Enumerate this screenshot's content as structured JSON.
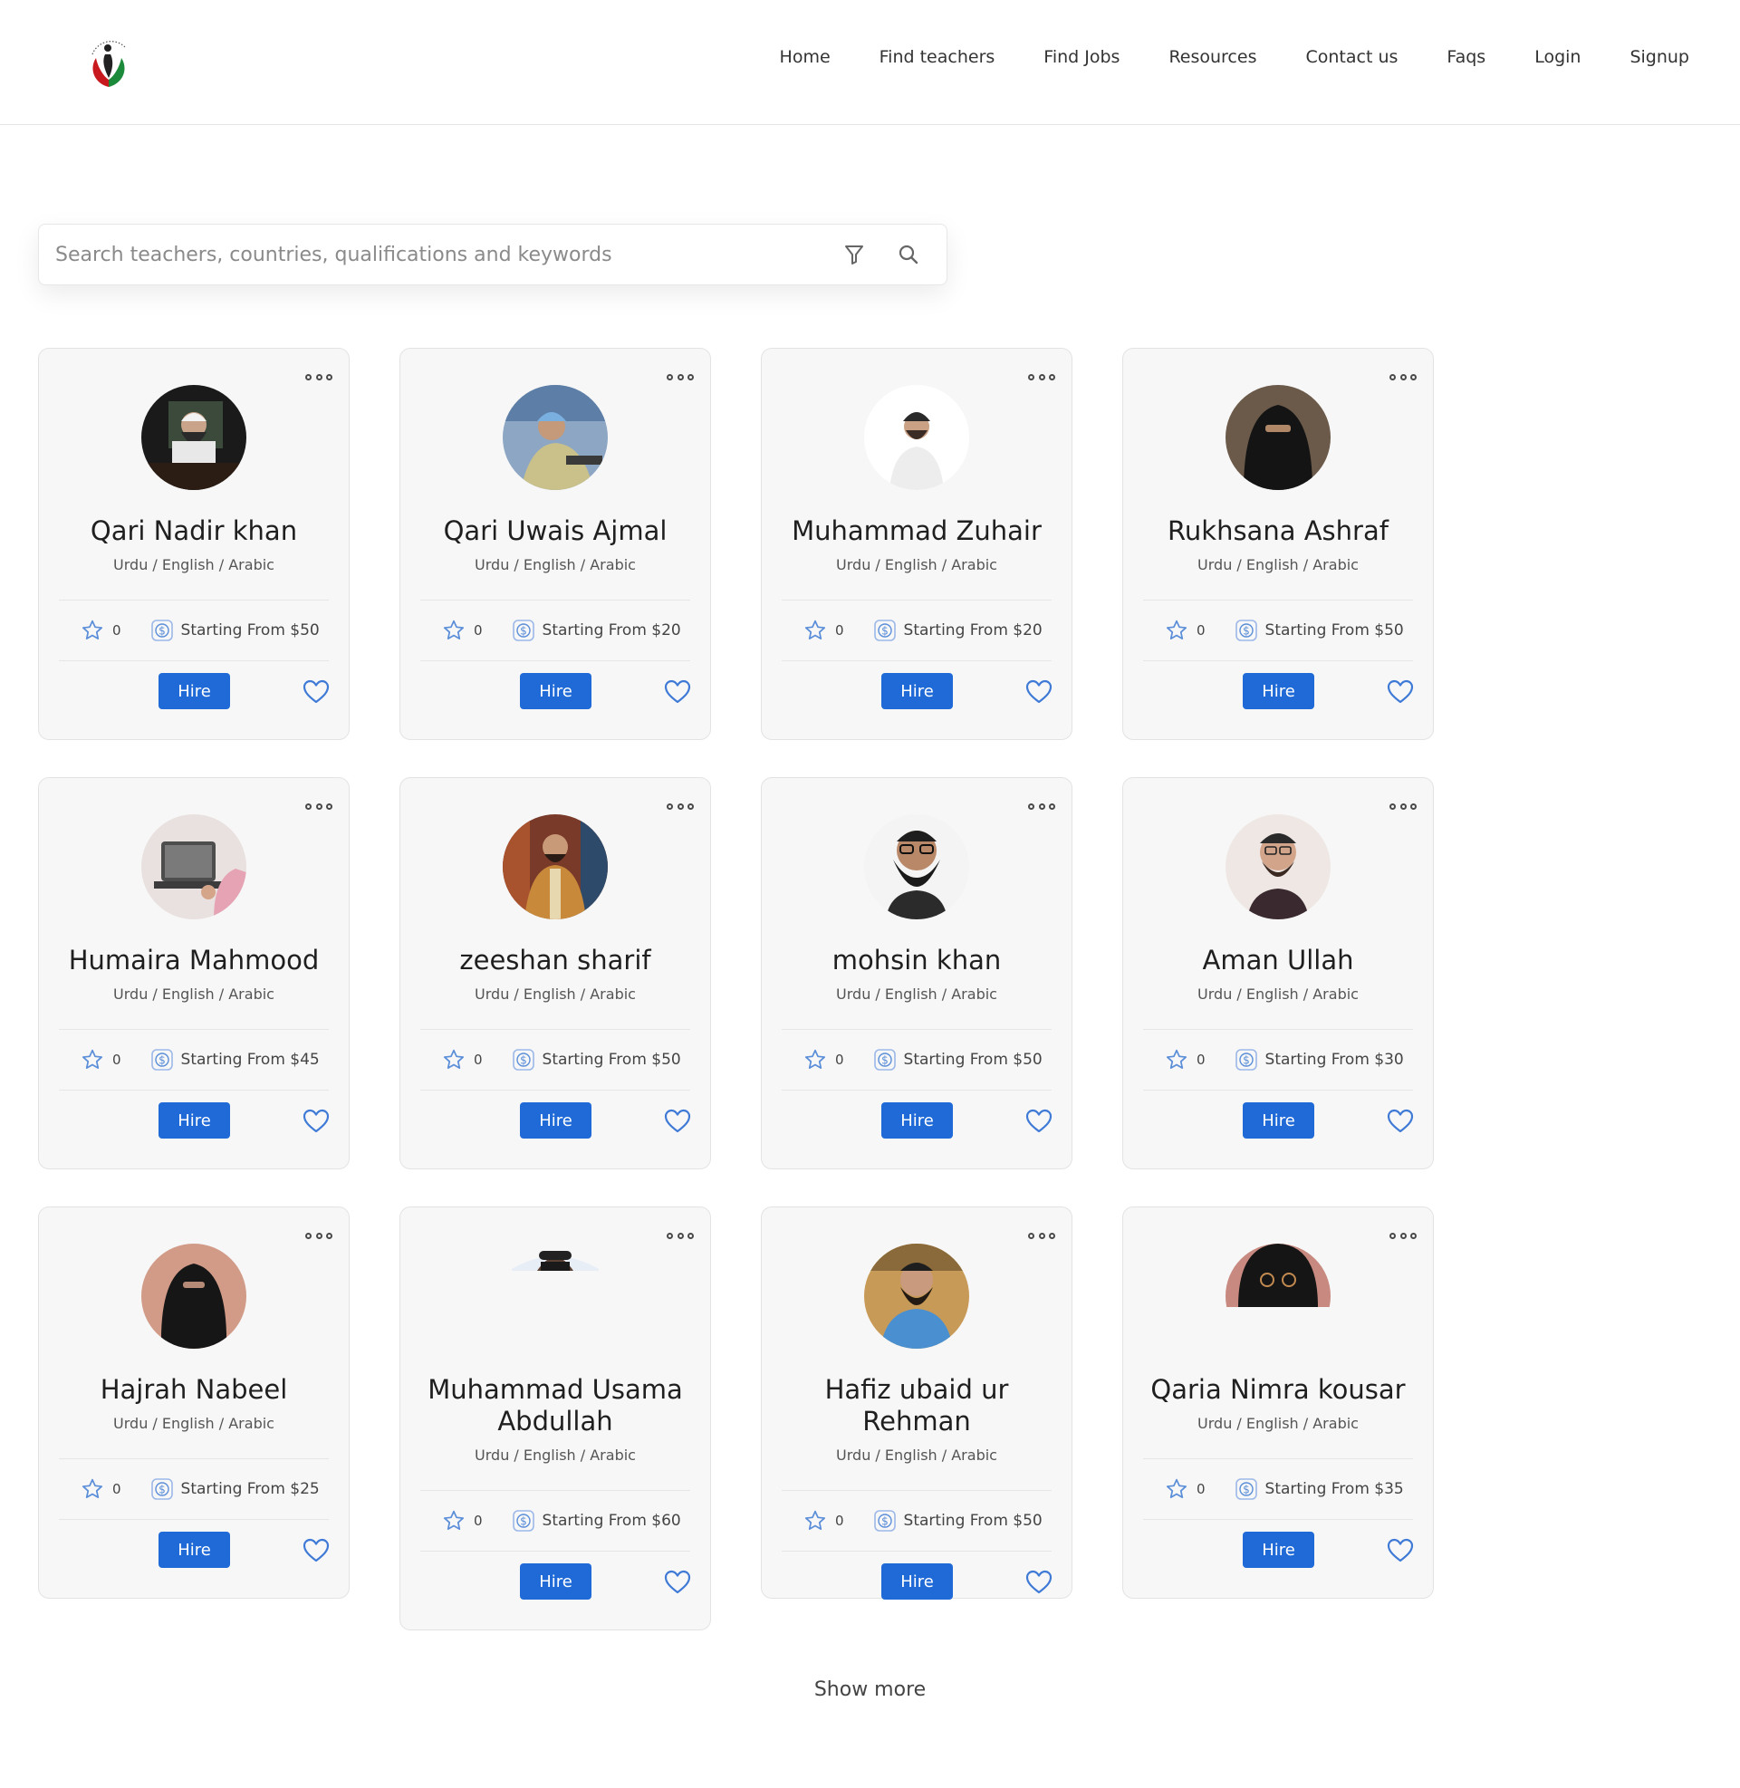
{
  "nav": [
    "Home",
    "Find teachers",
    "Find Jobs",
    "Resources",
    "Contact us",
    "Faqs",
    "Login",
    "Signup"
  ],
  "search": {
    "placeholder": "Search teachers, countries, qualifications and keywords"
  },
  "brand_colors": {
    "primary": "#1f6ad6",
    "icon": "#5b8ed8",
    "text": "#1f1f1f"
  },
  "icons": [
    "logo",
    "filter-icon",
    "search-icon",
    "more-icon",
    "star-icon",
    "dollar-icon",
    "heart-icon"
  ],
  "teachers": [
    {
      "name": "Qari Nadir khan",
      "langs": "Urdu / English / Arabic",
      "rating": "0",
      "price": "Starting From $50",
      "hire": "Hire"
    },
    {
      "name": "Qari Uwais Ajmal",
      "langs": "Urdu / English / Arabic",
      "rating": "0",
      "price": "Starting From $20",
      "hire": "Hire"
    },
    {
      "name": "Muhammad Zuhair",
      "langs": "Urdu / English / Arabic",
      "rating": "0",
      "price": "Starting From $20",
      "hire": "Hire"
    },
    {
      "name": "Rukhsana Ashraf",
      "langs": "Urdu / English / Arabic",
      "rating": "0",
      "price": "Starting From $50",
      "hire": "Hire"
    },
    {
      "name": "Humaira Mahmood",
      "langs": "Urdu / English / Arabic",
      "rating": "0",
      "price": "Starting From $45",
      "hire": "Hire"
    },
    {
      "name": "zeeshan sharif",
      "langs": "Urdu / English / Arabic",
      "rating": "0",
      "price": "Starting From $50",
      "hire": "Hire"
    },
    {
      "name": "mohsin khan",
      "langs": "Urdu / English / Arabic",
      "rating": "0",
      "price": "Starting From $50",
      "hire": "Hire"
    },
    {
      "name": "Aman Ullah",
      "langs": "Urdu / English / Arabic",
      "rating": "0",
      "price": "Starting From $30",
      "hire": "Hire"
    },
    {
      "name": "Hajrah Nabeel",
      "langs": "Urdu / English / Arabic",
      "rating": "0",
      "price": "Starting From $25",
      "hire": "Hire"
    },
    {
      "name": "Muhammad Usama Abdullah",
      "langs": "Urdu / English / Arabic",
      "rating": "0",
      "price": "Starting From $60",
      "hire": "Hire"
    },
    {
      "name": "Hafiz ubaid ur Rehman",
      "langs": "Urdu / English / Arabic",
      "rating": "0",
      "price": "Starting From $50",
      "hire": "Hire"
    },
    {
      "name": "Qaria Nimra kousar",
      "langs": "Urdu / English / Arabic",
      "rating": "0",
      "price": "Starting From $35",
      "hire": "Hire"
    }
  ],
  "show_more": "Show more"
}
